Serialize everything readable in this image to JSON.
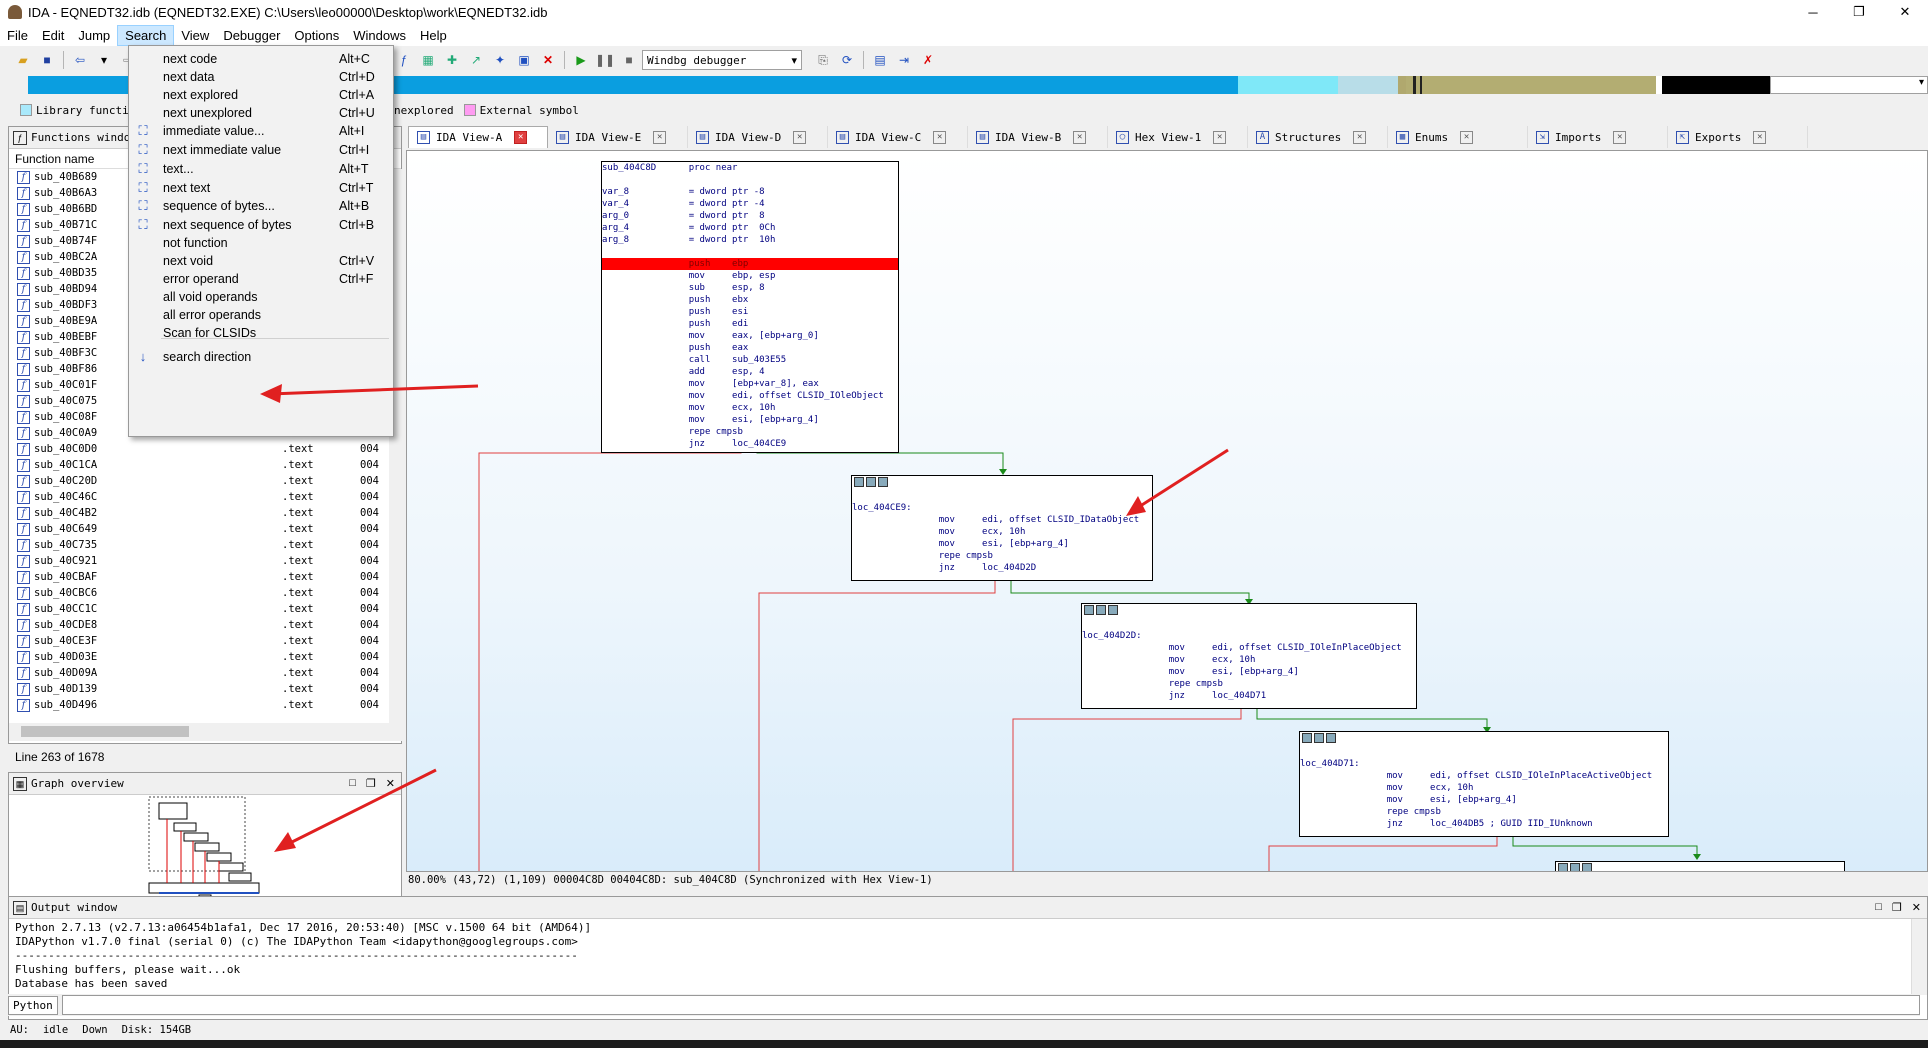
{
  "window": {
    "title": "IDA - EQNEDT32.idb (EQNEDT32.EXE) C:\\Users\\leo00000\\Desktop\\work\\EQNEDT32.idb",
    "minimize": "─",
    "maximize": "❐",
    "close": "✕"
  },
  "menubar": [
    "File",
    "Edit",
    "Jump",
    "Search",
    "View",
    "Debugger",
    "Options",
    "Windows",
    "Help"
  ],
  "toolbar": {
    "debugger": "Windbg debugger"
  },
  "legend": {
    "library": "Library functio",
    "unexplored": "Unexplored",
    "external": "External symbol"
  },
  "search_menu": {
    "items": [
      {
        "label": "next code",
        "key": "Alt+C",
        "icon": ""
      },
      {
        "label": "next data",
        "key": "Ctrl+D",
        "icon": ""
      },
      {
        "label": "next explored",
        "key": "Ctrl+A",
        "icon": ""
      },
      {
        "label": "next unexplored",
        "key": "Ctrl+U",
        "icon": ""
      },
      {
        "label": "immediate value...",
        "key": "Alt+I",
        "icon": "binoculars-icon"
      },
      {
        "label": "next immediate value",
        "key": "Ctrl+I",
        "icon": "binoculars-icon"
      },
      {
        "label": "text...",
        "key": "Alt+T",
        "icon": "binoculars-icon"
      },
      {
        "label": "next text",
        "key": "Ctrl+T",
        "icon": "binoculars-icon"
      },
      {
        "label": "sequence of bytes...",
        "key": "Alt+B",
        "icon": "binoculars-icon"
      },
      {
        "label": "next sequence of bytes",
        "key": "Ctrl+B",
        "icon": "binoculars-icon"
      },
      {
        "label": "not function",
        "key": "",
        "icon": ""
      },
      {
        "label": "next void",
        "key": "Ctrl+V",
        "icon": ""
      },
      {
        "label": "error operand",
        "key": "Ctrl+F",
        "icon": ""
      },
      {
        "label": "all void operands",
        "key": "",
        "icon": ""
      },
      {
        "label": "all error operands",
        "key": "",
        "icon": ""
      },
      {
        "label": "Scan for CLSIDs",
        "key": "",
        "icon": ""
      },
      {
        "label": "search direction",
        "key": "",
        "icon": "arrow-down-icon"
      }
    ]
  },
  "functions_window": {
    "title": "Functions window",
    "header": "Function name",
    "status": "Line 263 of 1678",
    "rows": [
      {
        "name": "sub_40B689",
        "seg": "",
        "start": ""
      },
      {
        "name": "sub_40B6A3",
        "seg": "",
        "start": ""
      },
      {
        "name": "sub_40B6BD",
        "seg": "",
        "start": ""
      },
      {
        "name": "sub_40B71C",
        "seg": "",
        "start": ""
      },
      {
        "name": "sub_40B74F",
        "seg": "",
        "start": ""
      },
      {
        "name": "sub_40BC2A",
        "seg": "",
        "start": ""
      },
      {
        "name": "sub_40BD35",
        "seg": "",
        "start": ""
      },
      {
        "name": "sub_40BD94",
        "seg": "",
        "start": ""
      },
      {
        "name": "sub_40BDF3",
        "seg": "",
        "start": ""
      },
      {
        "name": "sub_40BE9A",
        "seg": "",
        "start": ""
      },
      {
        "name": "sub_40BEBF",
        "seg": "",
        "start": ""
      },
      {
        "name": "sub_40BF3C",
        "seg": "",
        "start": ""
      },
      {
        "name": "sub_40BF86",
        "seg": "",
        "start": ""
      },
      {
        "name": "sub_40C01F",
        "seg": "",
        "start": ""
      },
      {
        "name": "sub_40C075",
        "seg": "",
        "start": ""
      },
      {
        "name": "sub_40C08F",
        "seg": "",
        "start": ""
      },
      {
        "name": "sub_40C0A9",
        "seg": ".text",
        "start": "004"
      },
      {
        "name": "sub_40C0D0",
        "seg": ".text",
        "start": "004"
      },
      {
        "name": "sub_40C1CA",
        "seg": ".text",
        "start": "004"
      },
      {
        "name": "sub_40C20D",
        "seg": ".text",
        "start": "004"
      },
      {
        "name": "sub_40C46C",
        "seg": ".text",
        "start": "004"
      },
      {
        "name": "sub_40C4B2",
        "seg": ".text",
        "start": "004"
      },
      {
        "name": "sub_40C649",
        "seg": ".text",
        "start": "004"
      },
      {
        "name": "sub_40C735",
        "seg": ".text",
        "start": "004"
      },
      {
        "name": "sub_40C921",
        "seg": ".text",
        "start": "004"
      },
      {
        "name": "sub_40CBAF",
        "seg": ".text",
        "start": "004"
      },
      {
        "name": "sub_40CBC6",
        "seg": ".text",
        "start": "004"
      },
      {
        "name": "sub_40CC1C",
        "seg": ".text",
        "start": "004"
      },
      {
        "name": "sub_40CDE8",
        "seg": ".text",
        "start": "004"
      },
      {
        "name": "sub_40CE3F",
        "seg": ".text",
        "start": "004"
      },
      {
        "name": "sub_40D03E",
        "seg": ".text",
        "start": "004"
      },
      {
        "name": "sub_40D09A",
        "seg": ".text",
        "start": "004"
      },
      {
        "name": "sub_40D139",
        "seg": ".text",
        "start": "004"
      },
      {
        "name": "sub_40D496",
        "seg": ".text",
        "start": "004"
      }
    ]
  },
  "graph_overview": {
    "title": "Graph overview"
  },
  "tabs": [
    {
      "label": "IDA View-A",
      "icon": "ida-view-icon",
      "active": true
    },
    {
      "label": "IDA View-E",
      "icon": "ida-view-icon",
      "active": false
    },
    {
      "label": "IDA View-D",
      "icon": "ida-view-icon",
      "active": false
    },
    {
      "label": "IDA View-C",
      "icon": "ida-view-icon",
      "active": false
    },
    {
      "label": "IDA View-B",
      "icon": "ida-view-icon",
      "active": false
    },
    {
      "label": "Hex View-1",
      "icon": "hex-view-icon",
      "active": false
    },
    {
      "label": "Structures",
      "icon": "structures-icon",
      "active": false
    },
    {
      "label": "Enums",
      "icon": "enums-icon",
      "active": false
    },
    {
      "label": "Imports",
      "icon": "imports-icon",
      "active": false
    },
    {
      "label": "Exports",
      "icon": "exports-icon",
      "active": false
    }
  ],
  "graph_nodes": [
    {
      "id": "n1",
      "lines": [
        "sub_404C8D      proc near",
        "",
        "var_8           = dword ptr -8",
        "var_4           = dword ptr -4",
        "arg_0           = dword ptr  8",
        "arg_4           = dword ptr  0Ch",
        "arg_8           = dword ptr  10h",
        "",
        "                push    ebp",
        "                mov     ebp, esp",
        "                sub     esp, 8",
        "                push    ebx",
        "                push    esi",
        "                push    edi",
        "                mov     eax, [ebp+arg_0]",
        "                push    eax",
        "                call    sub_403E55",
        "                add     esp, 4",
        "                mov     [ebp+var_8], eax",
        "                mov     edi, offset CLSID_IOleObject",
        "                mov     ecx, 10h",
        "                mov     esi, [ebp+arg_4]",
        "                repe cmpsb",
        "                jnz     loc_404CE9"
      ],
      "highlight": 8
    },
    {
      "id": "n2",
      "lines": [
        "loc_404CE9:",
        "                mov     edi, offset CLSID_IDataObject",
        "                mov     ecx, 10h",
        "                mov     esi, [ebp+arg_4]",
        "                repe cmpsb",
        "                jnz     loc_404D2D"
      ],
      "highlight": -1
    },
    {
      "id": "n3",
      "lines": [
        "loc_404D2D:",
        "                mov     edi, offset CLSID_IOleInPlaceObject",
        "                mov     ecx, 10h",
        "                mov     esi, [ebp+arg_4]",
        "                repe cmpsb",
        "                jnz     loc_404D71"
      ],
      "highlight": -1
    },
    {
      "id": "n4",
      "lines": [
        "loc_404D71:",
        "                mov     edi, offset CLSID_IOleInPlaceActiveObject",
        "                mov     ecx, 10h",
        "                mov     esi, [ebp+arg_4]",
        "                repe cmpsb",
        "                jnz     loc_404DB5 ; GUID IID_IUnknown"
      ],
      "highlight": -1
    }
  ],
  "graph_status": "80.00% (43,72) (1,109) 00004C8D 00404C8D: sub_404C8D (Synchronized with Hex View-1)",
  "output": {
    "title": "Output window",
    "lines": [
      "Python 2.7.13 (v2.7.13:a06454b1afa1, Dec 17 2016, 20:53:40) [MSC v.1500 64 bit (AMD64)]",
      "IDAPython v1.7.0 final (serial 0) (c) The IDAPython Team <idapython@googlegroups.com>",
      "-------------------------------------------------------------------------------------",
      "Flushing buffers, please wait...ok",
      "Database has been saved"
    ],
    "lang": "Python"
  },
  "statusbar": {
    "au": "AU:",
    "state": "idle",
    "dir": "Down",
    "disk": "Disk: 154GB"
  },
  "colors": {
    "accent": "#0a9ee0",
    "highlight": "#ff0000",
    "menu_hover": "#cce8ff"
  }
}
